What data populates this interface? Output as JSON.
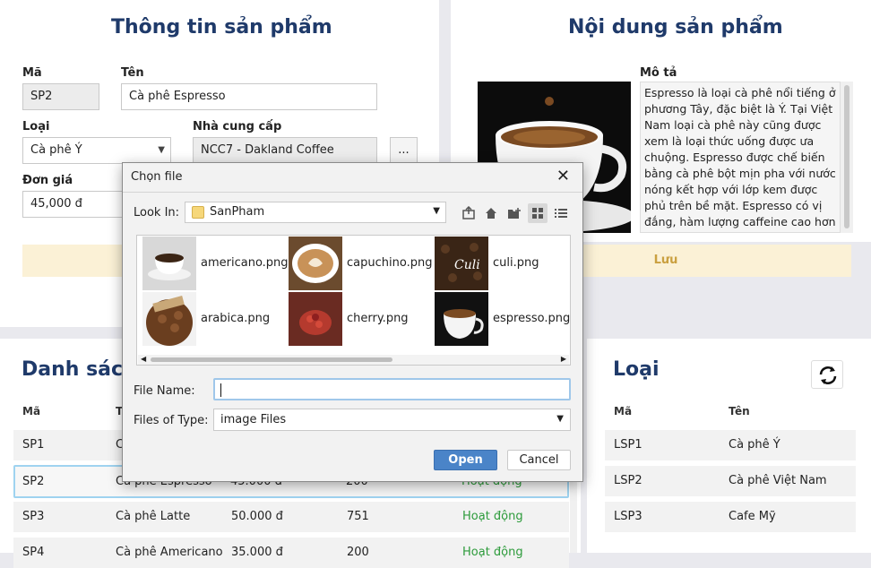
{
  "info": {
    "title": "Thông tin sản phẩm",
    "ma_label": "Mã",
    "ma_value": "SP2",
    "ten_label": "Tên",
    "ten_value": "Cà phê Espresso",
    "loai_label": "Loại",
    "loai_value": "Cà phê Ý",
    "ncc_label": "Nhà cung cấp",
    "ncc_value": "NCC7 - Dakland Coffee",
    "ncc_button": "...",
    "dongia_label": "Đơn giá",
    "dongia_value": "45,000 đ",
    "save_label": "Lưu"
  },
  "content": {
    "title": "Nội dung sản phẩm",
    "mota_label": "Mô tả",
    "mota_text": "Espresso là loại cà phê nổi tiếng ở phương Tây, đặc biệt là Ý. Tại Việt Nam loại cà phê này cũng được xem là loại thức uống được ưa chuộng. Espresso được chế biến bằng cà phê bột mịn pha với nước nóng kết hợp với lớp kem được phủ trên bề mặt. Espresso có vị đắng, hàm lượng caffeine cao hơn so với các loại đồ uống khác."
  },
  "list": {
    "title": "Danh sách",
    "headers": [
      "Mã",
      "T"
    ],
    "rows": [
      {
        "ma": "SP1",
        "ten": "C",
        "gia": "",
        "sl": "",
        "tt": ""
      },
      {
        "ma": "SP2",
        "ten": "Cà phê Espresso",
        "gia": "45.000 đ",
        "sl": "200",
        "tt": "Hoạt động"
      },
      {
        "ma": "SP3",
        "ten": "Cà phê Latte",
        "gia": "50.000 đ",
        "sl": "751",
        "tt": "Hoạt động"
      },
      {
        "ma": "SP4",
        "ten": "Cà phê Americano",
        "gia": "35.000 đ",
        "sl": "200",
        "tt": "Hoạt động"
      }
    ]
  },
  "category": {
    "title": "Loại",
    "headers": [
      "Mã",
      "Tên"
    ],
    "rows": [
      {
        "ma": "LSP1",
        "ten": "Cà phê Ý"
      },
      {
        "ma": "LSP2",
        "ten": "Cà phê Việt Nam"
      },
      {
        "ma": "LSP3",
        "ten": "Cafe Mỹ"
      }
    ]
  },
  "dialog": {
    "title": "Chọn file",
    "lookin_label": "Look In:",
    "lookin_value": "SanPham",
    "files": [
      {
        "name": "americano.png",
        "icon": "americano-thumbnail"
      },
      {
        "name": "capuchino.png",
        "icon": "capuchino-thumbnail"
      },
      {
        "name": "culi.png",
        "icon": "culi-thumbnail"
      },
      {
        "name": "arabica.png",
        "icon": "arabica-thumbnail"
      },
      {
        "name": "cherry.png",
        "icon": "cherry-thumbnail"
      },
      {
        "name": "espresso.png",
        "icon": "espresso-thumbnail"
      }
    ],
    "filename_label": "File Name:",
    "filename_value": "",
    "filetype_label": "Files of Type:",
    "filetype_value": "image Files",
    "open_label": "Open",
    "cancel_label": "Cancel"
  },
  "colors": {
    "heading": "#1f3a6a",
    "save_bg": "#fbf1d6",
    "status_green": "#2d9b3b",
    "open_blue": "#4a84c8"
  }
}
